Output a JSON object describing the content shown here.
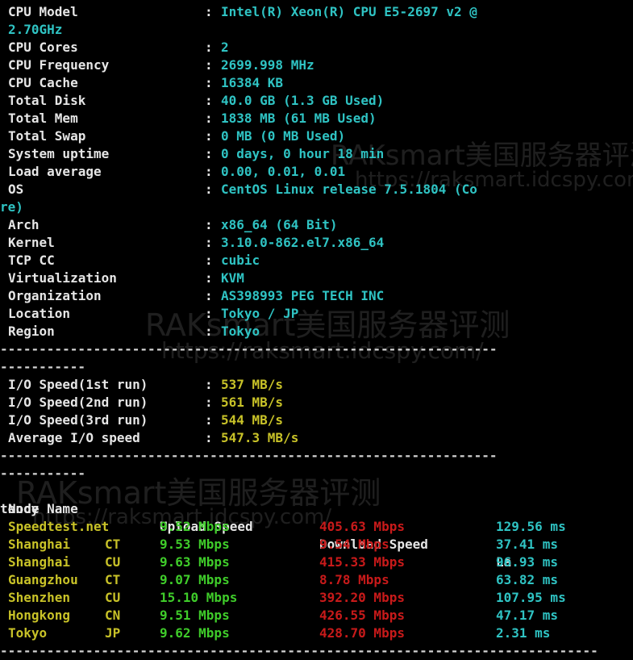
{
  "colors": {
    "label": "#e6e6e6",
    "value": "#2fc3c3",
    "io": "#c8c228",
    "upload": "#3fcc2a",
    "download": "#c81a1a",
    "latency": "#2fc3c3"
  },
  "sysinfo": [
    {
      "label": "CPU Model",
      "value": "Intel(R) Xeon(R) CPU E5-2697 v2 @",
      "wrap": "2.70GHz"
    },
    {
      "label": "CPU Cores",
      "value": "2"
    },
    {
      "label": "CPU Frequency",
      "value": "2699.998 MHz"
    },
    {
      "label": "CPU Cache",
      "value": "16384 KB"
    },
    {
      "label": "Total Disk",
      "value": "40.0 GB (1.3 GB Used)"
    },
    {
      "label": "Total Mem",
      "value": "1838 MB (61 MB Used)"
    },
    {
      "label": "Total Swap",
      "value": "0 MB (0 MB Used)"
    },
    {
      "label": "System uptime",
      "value": "0 days, 0 hour 18 min"
    },
    {
      "label": "Load average",
      "value": "0.00, 0.01, 0.01"
    },
    {
      "label": "OS",
      "value": "CentOS Linux release 7.5.1804 (Co",
      "wrap": "re)"
    },
    {
      "label": "Arch",
      "value": "x86_64 (64 Bit)"
    },
    {
      "label": "Kernel",
      "value": "3.10.0-862.el7.x86_64"
    },
    {
      "label": "TCP CC",
      "value": "cubic"
    },
    {
      "label": "Virtualization",
      "value": "KVM"
    },
    {
      "label": "Organization",
      "value": "AS398993 PEG TECH INC"
    },
    {
      "label": "Location",
      "value": "Tokyo / JP"
    },
    {
      "label": "Region",
      "value": "Tokyo"
    }
  ],
  "separator_long": "----------------------------------------------------------------",
  "separator_short": "-----------",
  "separator_full": "-----------------------------------------------------------------------------",
  "io": [
    {
      "label": "I/O Speed(1st run)",
      "value": "537 MB/s"
    },
    {
      "label": "I/O Speed(2nd run)",
      "value": "561 MB/s"
    },
    {
      "label": "I/O Speed(3rd run)",
      "value": "544 MB/s"
    },
    {
      "label": "Average I/O speed",
      "value": "547.3 MB/s"
    }
  ],
  "speed_header": {
    "node": "Node Name",
    "upload": "Upload Speed",
    "download": "Download Speed",
    "latency": "La",
    "latency_wrap": "tency"
  },
  "speed_rows": [
    {
      "node": "Speedtest.net",
      "isp": "",
      "upload": "9.52 Mbps",
      "download": "405.63 Mbps",
      "latency": "129.56 ms"
    },
    {
      "node": "Shanghai",
      "isp": "CT",
      "upload": "9.53 Mbps",
      "download": "9.54 Mbps",
      "latency": "37.41 ms"
    },
    {
      "node": "Shanghai",
      "isp": "CU",
      "upload": "9.63 Mbps",
      "download": "415.33 Mbps",
      "latency": "96.93 ms"
    },
    {
      "node": "Guangzhou",
      "isp": "CT",
      "upload": "9.07 Mbps",
      "download": "8.78 Mbps",
      "latency": "63.82 ms"
    },
    {
      "node": "Shenzhen",
      "isp": "CU",
      "upload": "15.10 Mbps",
      "download": "392.20 Mbps",
      "latency": "107.95 ms"
    },
    {
      "node": "Hongkong",
      "isp": "CN",
      "upload": "9.51 Mbps",
      "download": "426.55 Mbps",
      "latency": "47.17 ms"
    },
    {
      "node": "Tokyo",
      "isp": "JP",
      "upload": "9.62 Mbps",
      "download": "428.70 Mbps",
      "latency": "2.31 ms"
    }
  ],
  "watermark": {
    "brand": "RAKsmart美国服务器评测",
    "url": "https://raksmart.idcspy.com/"
  }
}
